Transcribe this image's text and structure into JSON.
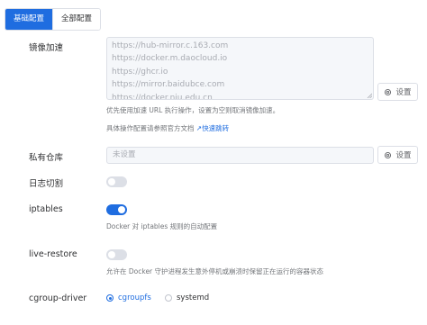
{
  "tabs": [
    {
      "label": "基础配置",
      "active": true
    },
    {
      "label": "全部配置",
      "active": false
    }
  ],
  "mirror": {
    "label": "镜像加速",
    "lines": [
      "https://hub-mirror.c.163.com",
      "https://docker.m.daocloud.io",
      "https://ghcr.io",
      "https://mirror.baidubce.com",
      "https://docker.nju.edu.cn"
    ],
    "set_label": "设置",
    "help1": "优先使用加速 URL 执行操作，设置为空则取消镜像加速。",
    "help2": "具体操作配置请参照官方文档",
    "link_label": "快速跳转"
  },
  "registry": {
    "label": "私有仓库",
    "placeholder": "未设置",
    "set_label": "设置"
  },
  "log_rotate": {
    "label": "日志切割",
    "on": false
  },
  "iptables": {
    "label": "iptables",
    "on": true,
    "help": "Docker 对 iptables 规则的自动配置"
  },
  "live_restore": {
    "label": "live-restore",
    "on": false,
    "help": "允许在 Docker 守护进程发生意外停机或崩溃时保留正在运行的容器状态"
  },
  "cgroup": {
    "label": "cgroup-driver",
    "options": [
      "cgroupfs",
      "systemd"
    ],
    "selected": "cgroupfs"
  },
  "colors": {
    "accent": "#1f6de0",
    "border": "#dcdfe6",
    "disabled_bg": "#f5f7fa",
    "muted": "#73767a"
  }
}
